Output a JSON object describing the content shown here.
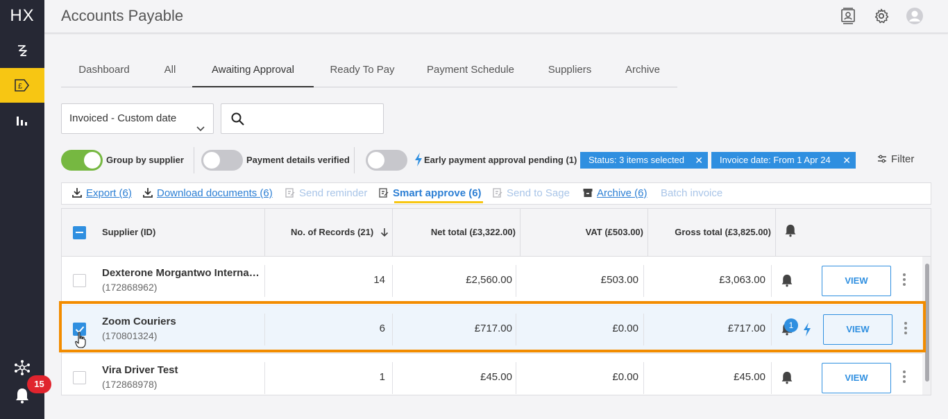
{
  "app": {
    "logo": "HX",
    "title": "Accounts Payable",
    "notification_count": "15"
  },
  "sidebar": {
    "items": [
      {
        "icon": "workflow-icon"
      },
      {
        "icon": "invoice-pound-icon",
        "active": true
      },
      {
        "icon": "bar-chart-icon"
      },
      {
        "icon": "network-icon"
      },
      {
        "icon": "bell-icon"
      }
    ]
  },
  "header_icons": [
    "contacts-icon",
    "gear-icon",
    "user-avatar-icon"
  ],
  "tabs": [
    {
      "label": "Dashboard"
    },
    {
      "label": "All"
    },
    {
      "label": "Awaiting Approval",
      "active": true
    },
    {
      "label": "Ready To Pay"
    },
    {
      "label": "Payment Schedule"
    },
    {
      "label": "Suppliers"
    },
    {
      "label": "Archive"
    }
  ],
  "filters": {
    "date_select": "Invoiced - Custom date",
    "search_placeholder": "",
    "group_by_supplier": {
      "label": "Group by supplier",
      "on": true
    },
    "payment_details_verified": {
      "label": "Payment details verified",
      "on": false
    },
    "early_payment": {
      "label": "Early payment approval pending (1)",
      "on": false
    },
    "chips": [
      {
        "label": "Status: 3 items selected"
      },
      {
        "label": "Invoice date: From 1 Apr 24"
      }
    ],
    "filter_label": "Filter"
  },
  "actions": {
    "export": "Export (6)",
    "download": "Download documents (6)",
    "send_reminder": "Send reminder",
    "smart_approve": "Smart approve (6)",
    "send_to_sage": "Send to Sage",
    "archive": "Archive (6)",
    "batch_invoice": "Batch invoice"
  },
  "table": {
    "columns": {
      "supplier": "Supplier (ID)",
      "records": "No. of Records (21)",
      "net": "Net total (£3,322.00)",
      "vat": "VAT (£503.00)",
      "gross": "Gross total (£3,825.00)"
    },
    "rows": [
      {
        "name": "Dexterone Morgantwo International",
        "id": "(172868962)",
        "records": "14",
        "net": "£2,560.00",
        "vat": "£503.00",
        "gross": "£3,063.00",
        "checked": false,
        "view": "VIEW"
      },
      {
        "name": "Zoom Couriers",
        "id": "(170801324)",
        "records": "6",
        "net": "£717.00",
        "vat": "£0.00",
        "gross": "£717.00",
        "checked": true,
        "notification_badge": "1",
        "view": "VIEW"
      },
      {
        "name": "Vira Driver Test",
        "id": "(172868978)",
        "records": "1",
        "net": "£45.00",
        "vat": "£0.00",
        "gross": "£45.00",
        "checked": false,
        "view": "VIEW"
      }
    ]
  },
  "colors": {
    "sidebar_bg": "#262834",
    "active_yellow": "#f7c613",
    "accent_blue": "#2f8fe0",
    "toggle_green": "#76b841",
    "highlight_orange": "#f28c00",
    "badge_red": "#e0242e"
  }
}
